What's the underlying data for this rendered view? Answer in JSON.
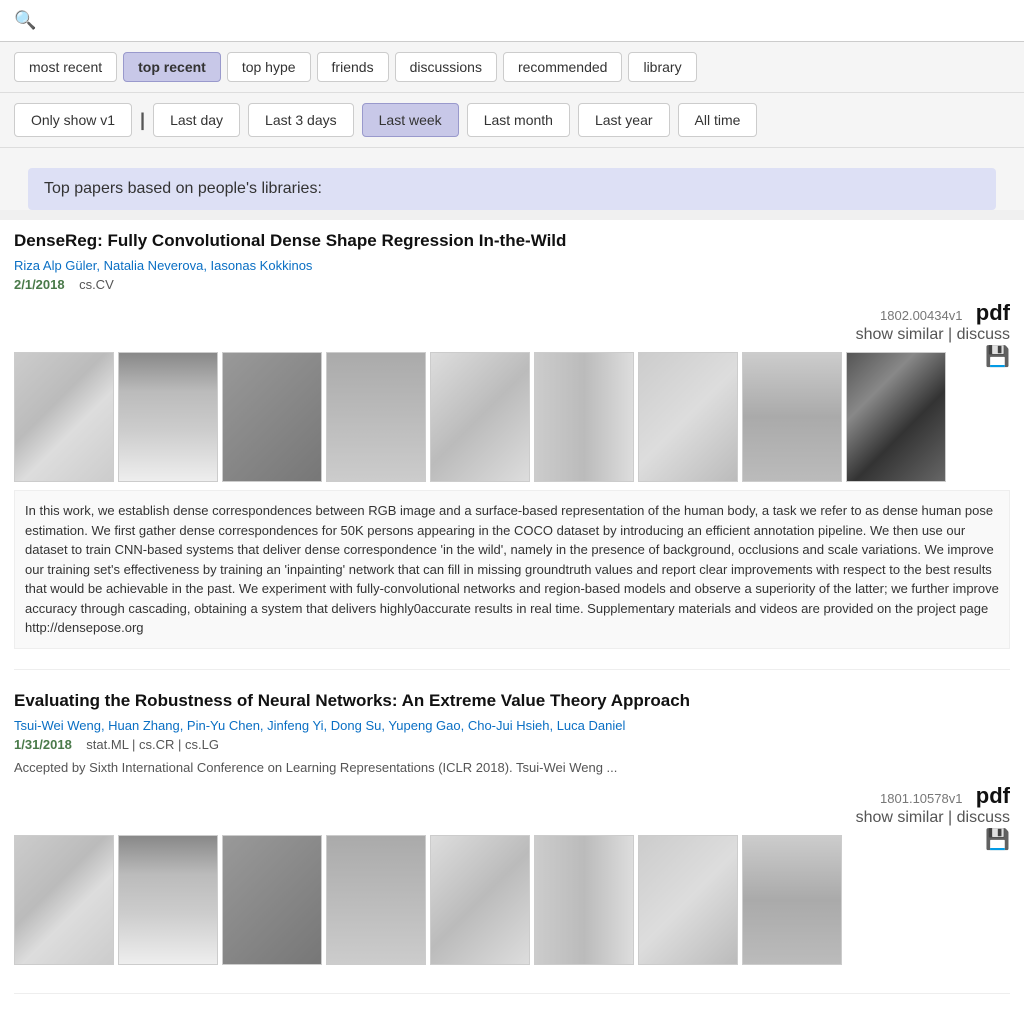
{
  "search": {
    "placeholder": ""
  },
  "nav": {
    "tabs": [
      {
        "label": "most recent",
        "active": false
      },
      {
        "label": "top recent",
        "active": true
      },
      {
        "label": "top hype",
        "active": false
      },
      {
        "label": "friends",
        "active": false
      },
      {
        "label": "discussions",
        "active": false
      },
      {
        "label": "recommended",
        "active": false
      },
      {
        "label": "library",
        "active": false
      }
    ]
  },
  "timeFilter": {
    "showV1Label": "Only show v1",
    "separator": "|",
    "buttons": [
      {
        "label": "Last day",
        "active": false
      },
      {
        "label": "Last 3 days",
        "active": false
      },
      {
        "label": "Last week",
        "active": true
      },
      {
        "label": "Last month",
        "active": false
      },
      {
        "label": "Last year",
        "active": false
      },
      {
        "label": "All time",
        "active": false
      }
    ]
  },
  "banner": {
    "text": "Top papers based on people's libraries:"
  },
  "papers": [
    {
      "title": "DenseReg: Fully Convolutional Dense Shape Regression In-the-Wild",
      "authors": "Riza Alp Güler, Natalia Neverova, Iasonas Kokkinos",
      "date": "2/1/2018",
      "categories": "cs.CV",
      "version": "1802.00434v1",
      "accepted": null,
      "abstract": "In this work, we establish dense correspondences between RGB image and a surface-based representation of the human body, a task we refer to as dense human pose estimation. We first gather dense correspondences for 50K persons appearing in the COCO dataset by introducing an efficient annotation pipeline. We then use our dataset to train CNN-based systems that deliver dense correspondence 'in the wild', namely in the presence of background, occlusions and scale variations. We improve our training set's effectiveness by training an 'inpainting' network that can fill in missing groundtruth values and report clear improvements with respect to the best results that would be achievable in the past. We experiment with fully-convolutional networks and region-based models and observe a superiority of the latter; we further improve accuracy through cascading, obtaining a system that delivers highly0accurate results in real time. Supplementary materials and videos are provided on the project page http://densepose.org",
      "thumbs": 9
    },
    {
      "title": "Evaluating the Robustness of Neural Networks: An Extreme Value Theory Approach",
      "authors": "Tsui-Wei Weng, Huan Zhang, Pin-Yu Chen, Jinfeng Yi, Dong Su, Yupeng Gao, Cho-Jui Hsieh, Luca Daniel",
      "date": "1/31/2018",
      "categories": "stat.ML | cs.CR | cs.LG",
      "version": "1801.10578v1",
      "accepted": "Accepted by Sixth International Conference on Learning Representations (ICLR 2018). Tsui-Wei Weng ...",
      "abstract": null,
      "thumbs": 8
    }
  ],
  "icons": {
    "search": "🔍",
    "save": "💾",
    "pdf": "pdf"
  }
}
